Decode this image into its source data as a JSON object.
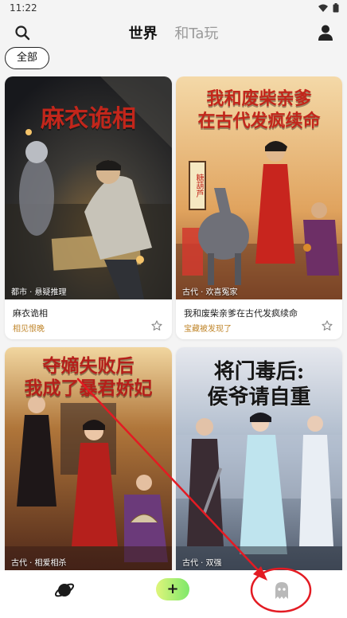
{
  "status_bar": {
    "time": "11:22",
    "icons": [
      "wifi-icon",
      "battery-icon"
    ]
  },
  "header": {
    "tabs": [
      {
        "label": "世界",
        "active": true
      },
      {
        "label": "和Ta玩",
        "active": false
      }
    ],
    "icons": {
      "left": "search-icon",
      "right": "user-icon"
    }
  },
  "filter": {
    "label": "全部"
  },
  "cards": [
    {
      "cover_title": "麻衣诡相",
      "genre": "都市 · 悬疑推理",
      "title": "麻衣诡相",
      "subtitle": "相见恨晚"
    },
    {
      "cover_title_line1": "我和废柴亲爹",
      "cover_title_line2": "在古代发疯续命",
      "genre": "古代 · 欢喜冤家",
      "title": "我和废柴亲爹在古代发疯续命",
      "subtitle": "宝藏被发现了",
      "sign": "糖葫芦"
    },
    {
      "cover_title_line1": "夺嫡失败后",
      "cover_title_line2": "我成了暴君娇妃",
      "genre": "古代 · 相爱相杀"
    },
    {
      "cover_title_line1": "将门毒后:",
      "cover_title_line2": "侯爷请自重",
      "genre": "古代 · 双强"
    }
  ],
  "bottom_nav": {
    "add_label": "+",
    "icons": [
      "planet-icon",
      "ghost-icon"
    ]
  },
  "colors": {
    "accent": "#7ee86a",
    "annotation": "#e31b23",
    "subtitle": "#c0862b"
  }
}
